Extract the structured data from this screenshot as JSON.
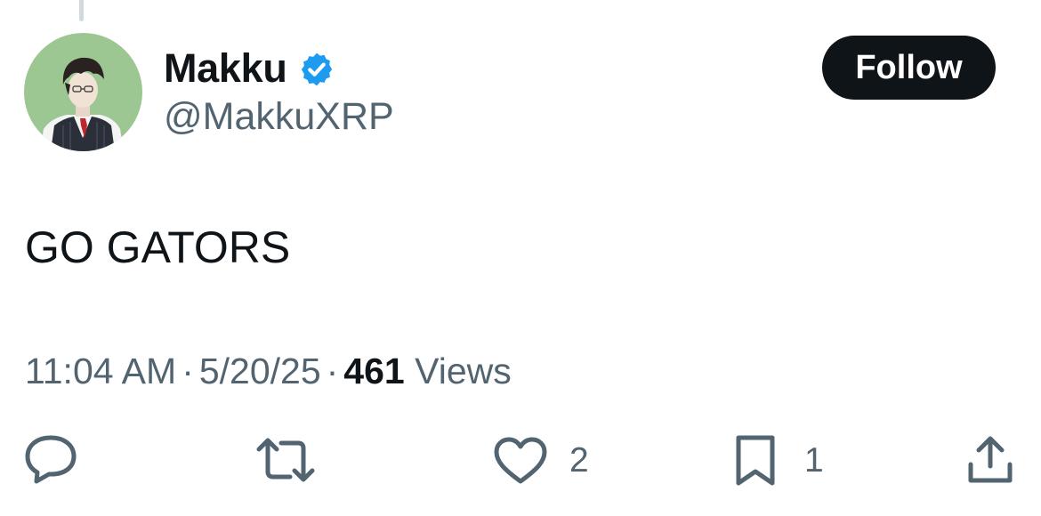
{
  "author": {
    "display_name": "Makku",
    "handle": "@MakkuXRP",
    "verified_icon": "verified-badge-icon"
  },
  "follow_label": "Follow",
  "tweet": {
    "text": "GO GATORS",
    "time": "11:04 AM",
    "date": "5/20/25",
    "separator": "·",
    "views_count": "461",
    "views_label": "Views"
  },
  "actions": {
    "reply_icon": "reply-icon",
    "retweet_icon": "retweet-icon",
    "like_icon": "heart-icon",
    "like_count": "2",
    "bookmark_icon": "bookmark-icon",
    "bookmark_count": "1",
    "share_icon": "share-icon"
  },
  "colors": {
    "primary_text": "#0f1419",
    "secondary_text": "#536471",
    "verified_blue": "#1d9bf0",
    "follow_bg": "#0f1419",
    "avatar_bg": "#9dc792"
  }
}
